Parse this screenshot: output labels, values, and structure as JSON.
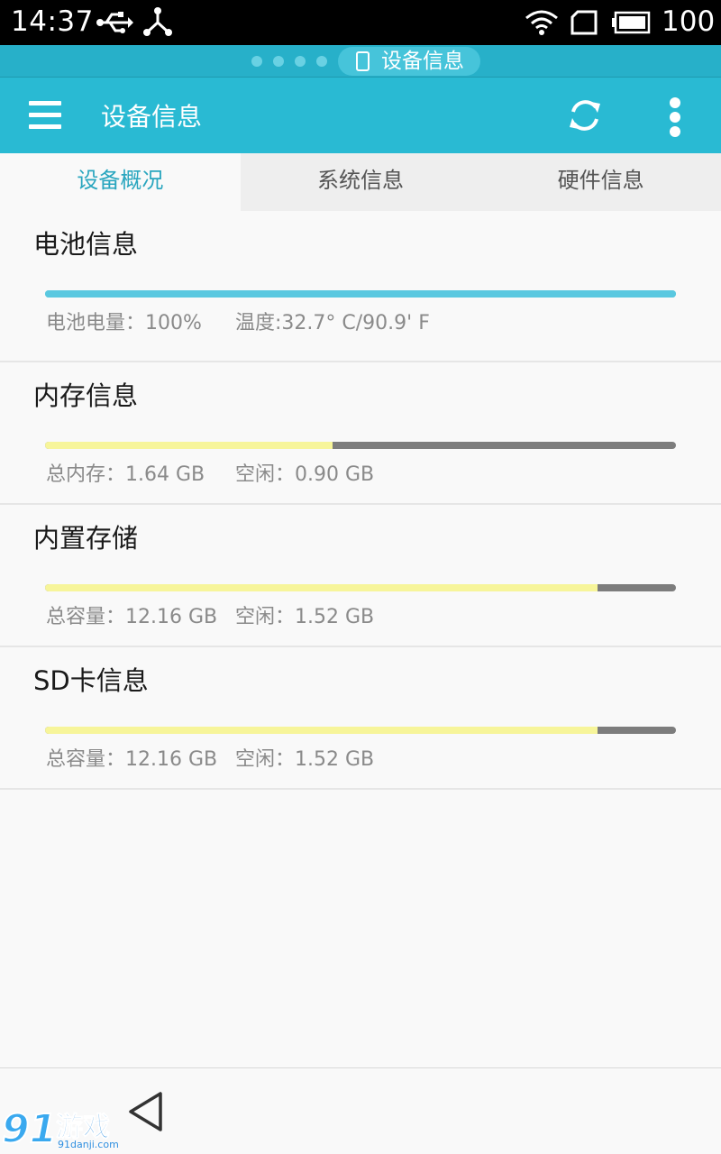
{
  "status_bar": {
    "time": "14:37",
    "battery_level": "100",
    "icons": [
      "usb-icon",
      "usb-device-icon",
      "wifi-icon",
      "sim-icon",
      "battery-icon"
    ]
  },
  "notification": {
    "label": "设备信息",
    "icon": "phone-icon"
  },
  "app_bar": {
    "title": "设备信息",
    "icons": [
      "menu-icon",
      "refresh-icon",
      "more-vert-icon"
    ]
  },
  "tabs": [
    {
      "label": "设备概况",
      "active": true
    },
    {
      "label": "系统信息",
      "active": false
    },
    {
      "label": "硬件信息",
      "active": false
    }
  ],
  "sections": [
    {
      "title": "电池信息",
      "progress": 1.0,
      "line_a": "电池电量：100%",
      "line_b": "温度:32.7° C/90.9' F"
    },
    {
      "title": "内存信息",
      "progress": 0.455,
      "line_a": "总内存：1.64 GB",
      "line_b": "空闲：0.90 GB"
    },
    {
      "title": "内置存储",
      "progress": 0.875,
      "line_a": "总容量：12.16 GB",
      "line_b": "空闲：1.52 GB"
    },
    {
      "title": "SD卡信息",
      "progress": 0.875,
      "line_a": "总容量：12.16 GB",
      "line_b": "空闲：1.52 GB"
    }
  ],
  "colors": {
    "accent": "#29bad3",
    "battery_bar": "#5ac8e0",
    "usage_bar": "#f7f59a",
    "bar_track": "#7d7d7d"
  },
  "watermark": {
    "number": "91",
    "text": "游戏",
    "url": "91danji.com"
  }
}
